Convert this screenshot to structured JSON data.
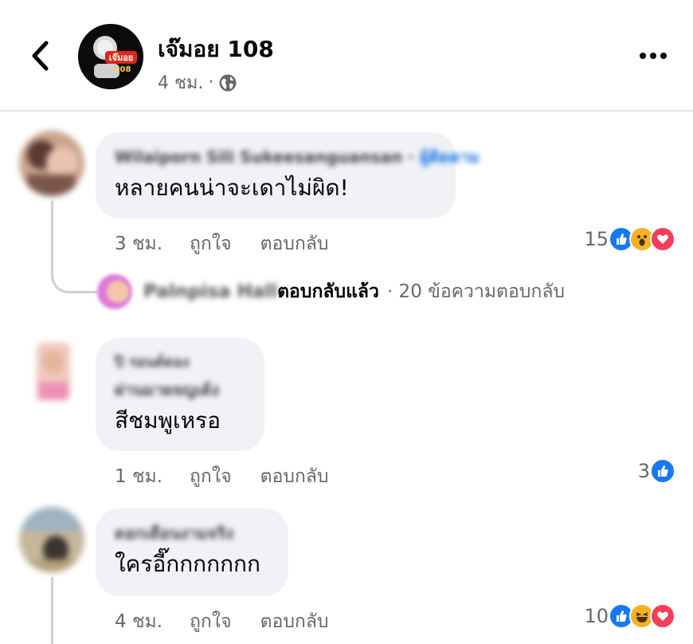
{
  "post": {
    "page_name": "เจ๊มอย 108",
    "time": "4 ชม.",
    "separator": "·",
    "logo_text": "เจ๊มอย",
    "logo_subtext": "108"
  },
  "comments": [
    {
      "author": "Wilaiporn Sili Sukeesanguansan",
      "tag": "ผู้ติดตาม",
      "text": "หลายคนน่าจะเดาไม่ผิด!",
      "time": "3 ชม.",
      "like_label": "ถูกใจ",
      "reply_label": "ตอบกลับ",
      "reaction_count": "15",
      "reactions": [
        "like",
        "wow",
        "love"
      ],
      "reply_preview": {
        "author": "Palnpisa Hall",
        "replied_label": "ตอบกลับแล้ว",
        "count_text": "· 20 ข้อความตอบกลับ"
      }
    },
    {
      "author_line1": "ปิ รอนด์ดอง",
      "author_line2": "ผ่านมาผจญเด้ง",
      "text": "สีชมพูเหรอ",
      "time": "1 ชม.",
      "like_label": "ถูกใจ",
      "reply_label": "ตอบกลับ",
      "reaction_count": "3",
      "reactions": [
        "like"
      ]
    },
    {
      "author": "ดอกเดือนงามจริง",
      "text": "ใครอี๊กกกกกกก",
      "time": "4 ชม.",
      "like_label": "ถูกใจ",
      "reply_label": "ตอบกลับ",
      "reaction_count": "10",
      "reactions": [
        "like",
        "haha",
        "love"
      ]
    }
  ],
  "colors": {
    "like": "#1877f2",
    "love": "#f33e58",
    "wow": "#f7b125",
    "secondary_text": "#65676b",
    "bubble": "#f0f2f5"
  }
}
